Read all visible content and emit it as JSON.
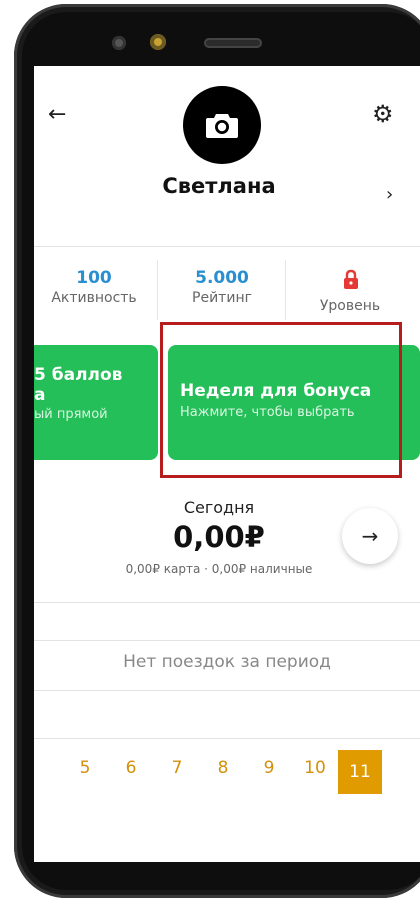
{
  "header": {
    "back_icon": "arrow-left-icon",
    "avatar_icon": "camera-icon",
    "settings_icon": "gear-icon",
    "name": "Светлана",
    "chevron": "›"
  },
  "stats": [
    {
      "value": "100",
      "label": "Активность"
    },
    {
      "value": "5.000",
      "label": "Рейтинг"
    },
    {
      "value": "",
      "label": "Уровень",
      "icon": "lock-icon"
    }
  ],
  "cards": {
    "left": {
      "title": "5 баллов",
      "title2": "а",
      "subtitle": "ый прямой"
    },
    "main": {
      "title": "Неделя для бонуса",
      "subtitle": "Нажмите, чтобы выбрать"
    }
  },
  "today": {
    "label": "Сегодня",
    "amount": "0,00₽",
    "details": "0,00₽ карта · 0,00₽ наличные",
    "next_icon": "arrow-right-icon"
  },
  "trips": {
    "empty_text": "Нет поездок за период"
  },
  "days": [
    "5",
    "6",
    "7",
    "8",
    "9",
    "10",
    "11"
  ],
  "selected_day": "11",
  "colors": {
    "accent_blue": "#2a8fd1",
    "card_green": "#24bf58",
    "highlight_red": "#b71c1c",
    "day_orange": "#d4900a",
    "lock_red": "#e53935"
  }
}
